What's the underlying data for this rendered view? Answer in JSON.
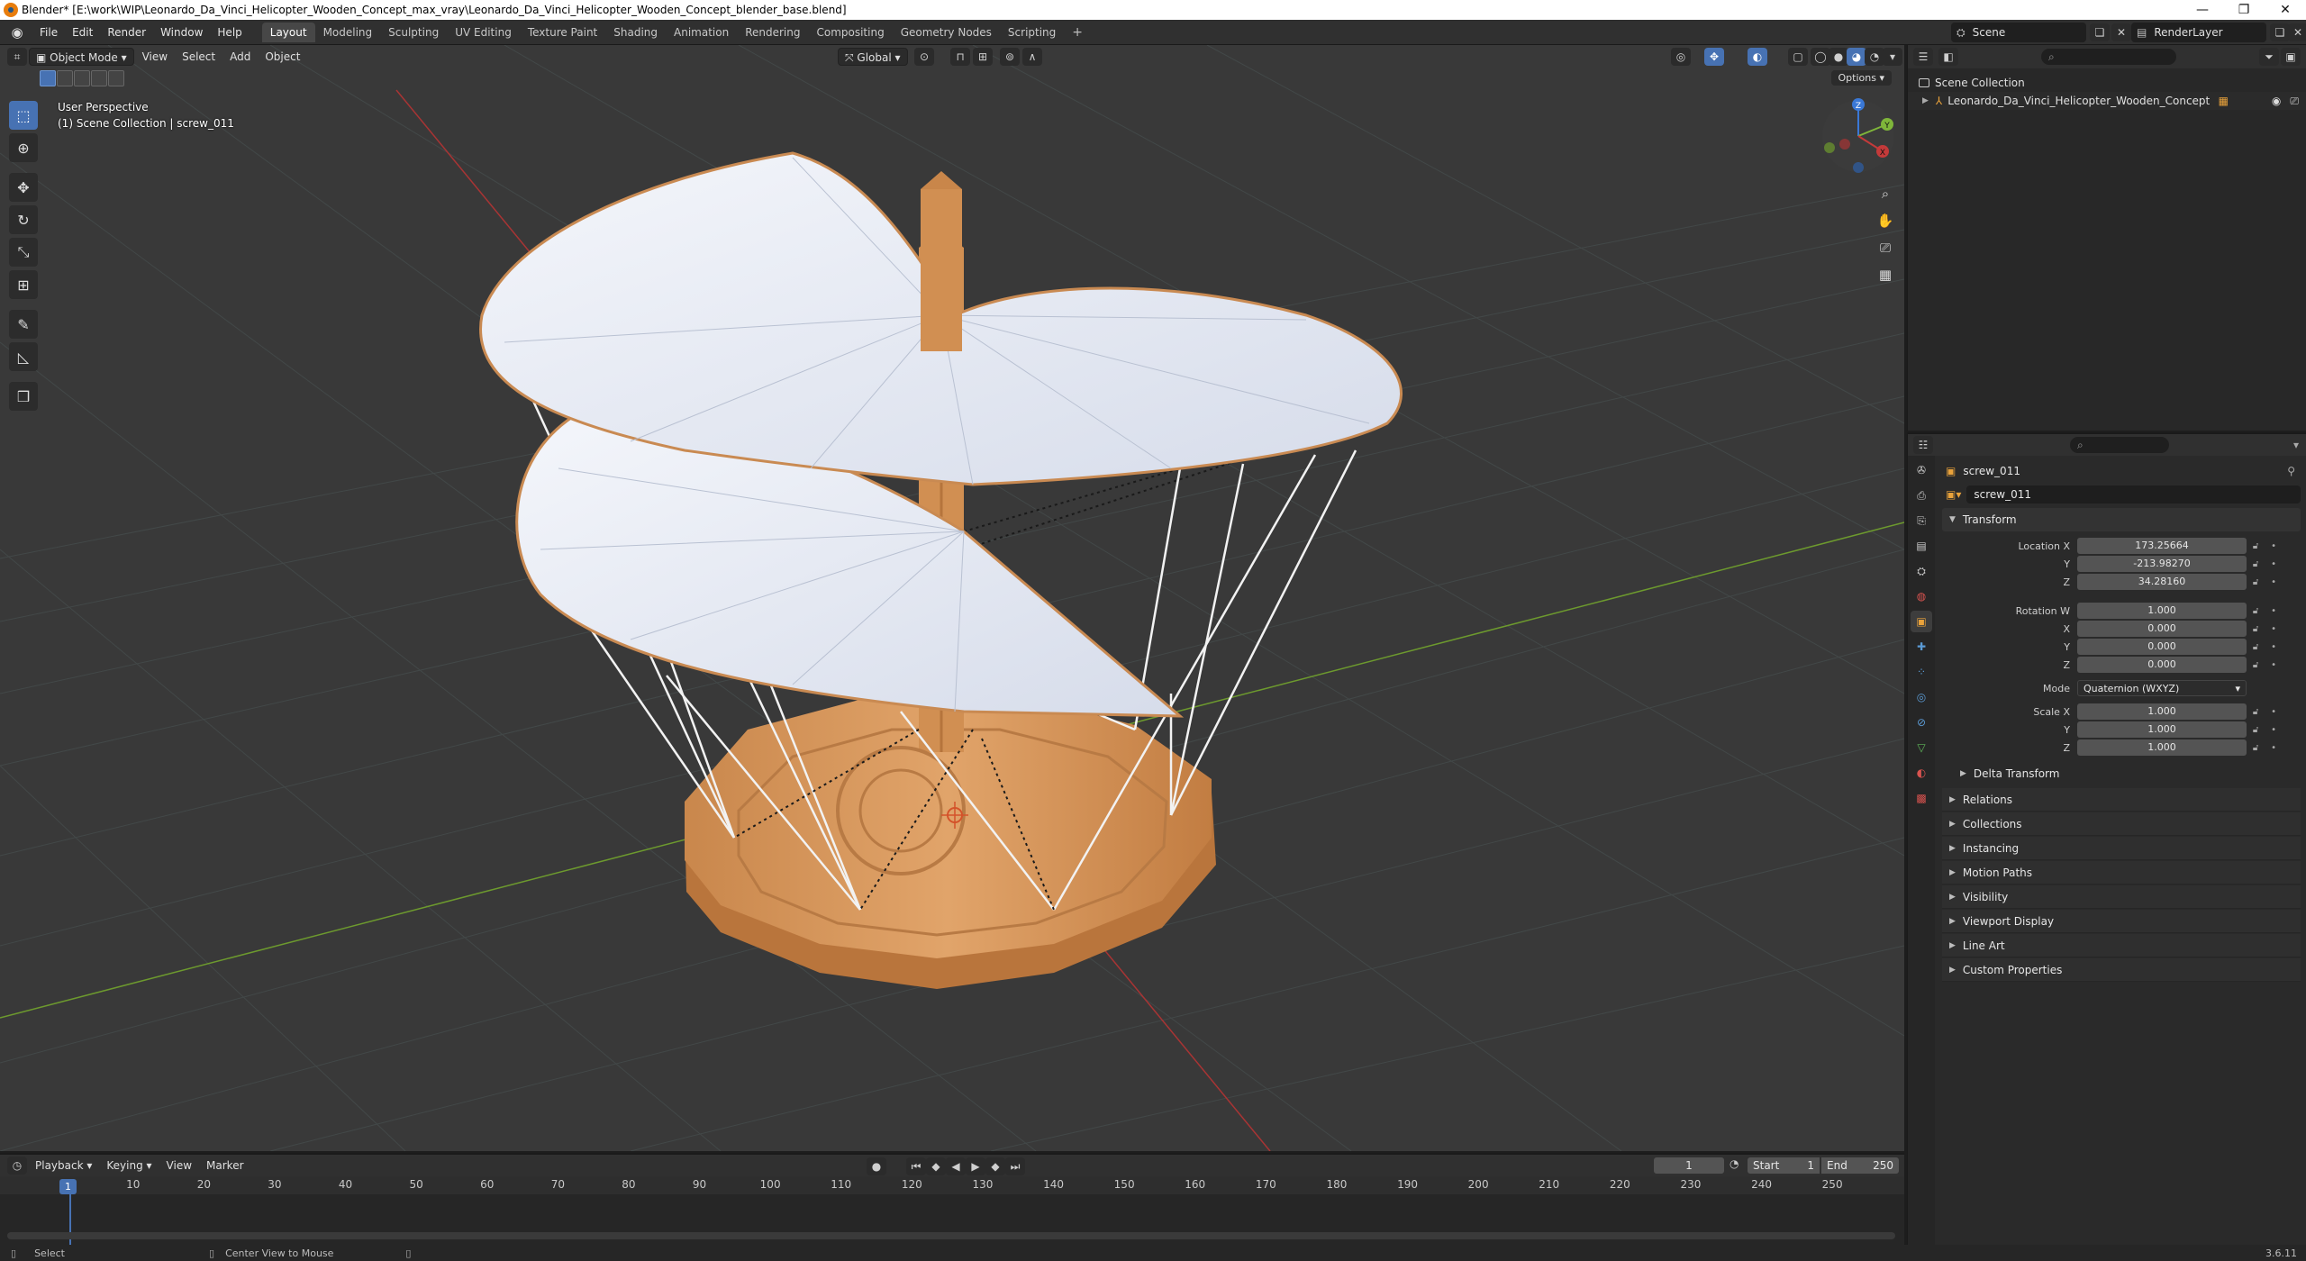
{
  "window": {
    "title": "Blender* [E:\\work\\WIP\\Leonardo_Da_Vinci_Helicopter_Wooden_Concept_max_vray\\Leonardo_Da_Vinci_Helicopter_Wooden_Concept_blender_base.blend]",
    "minimize": "—",
    "maximize": "❐",
    "close": "✕"
  },
  "menu": [
    "File",
    "Edit",
    "Render",
    "Window",
    "Help"
  ],
  "workspaces": [
    "Layout",
    "Modeling",
    "Sculpting",
    "UV Editing",
    "Texture Paint",
    "Shading",
    "Animation",
    "Rendering",
    "Compositing",
    "Geometry Nodes",
    "Scripting",
    "+"
  ],
  "scene": {
    "name": "Scene",
    "render_layer": "RenderLayer"
  },
  "viewport": {
    "mode": "Object Mode",
    "menus": [
      "View",
      "Select",
      "Add",
      "Object"
    ],
    "transform_orientation": "Global",
    "info_line1": "User Perspective",
    "info_line2": "(1) Scene Collection | screw_011",
    "options_label": "Options",
    "gizmo": {
      "x": "X",
      "y": "Y",
      "z": "Z"
    }
  },
  "outliner": {
    "root": "Scene Collection",
    "items": [
      "Leonardo_Da_Vinci_Helicopter_Wooden_Concept"
    ]
  },
  "properties": {
    "object_name": "screw_011",
    "data_name": "screw_011",
    "transform_title": "Transform",
    "location": {
      "label": "Location X",
      "x": "173.25664",
      "y": "-213.98270",
      "z": "34.28160"
    },
    "rotation": {
      "label": "Rotation W",
      "w": "1.000",
      "x": "0.000",
      "y": "0.000",
      "z": "0.000"
    },
    "axis_labels": {
      "x": "X",
      "y": "Y",
      "z": "Z"
    },
    "mode_label": "Mode",
    "mode_value": "Quaternion (WXYZ)",
    "scale": {
      "label": "Scale X",
      "x": "1.000",
      "y": "1.000",
      "z": "1.000"
    },
    "delta_transform": "Delta Transform",
    "panels": [
      "Relations",
      "Collections",
      "Instancing",
      "Motion Paths",
      "Visibility",
      "Viewport Display",
      "Line Art",
      "Custom Properties"
    ]
  },
  "timeline": {
    "menus": [
      "Playback",
      "Keying",
      "View",
      "Marker"
    ],
    "current_frame": "1",
    "start_label": "Start",
    "start": "1",
    "end_label": "End",
    "end": "250",
    "ticks": [
      "10",
      "20",
      "30",
      "40",
      "50",
      "60",
      "70",
      "80",
      "90",
      "100",
      "110",
      "120",
      "130",
      "140",
      "150",
      "160",
      "170",
      "180",
      "190",
      "200",
      "210",
      "220",
      "230",
      "240",
      "250"
    ]
  },
  "status": {
    "select": "Select",
    "center_view": "Center View to Mouse",
    "version": "3.6.11"
  },
  "colors": {
    "accent": "#4772b3",
    "wood": "#d9975a",
    "sail": "#e8ecf4",
    "x_axis": "#c43a3a",
    "y_axis": "#7fb63a",
    "z_axis": "#3a78d6"
  }
}
